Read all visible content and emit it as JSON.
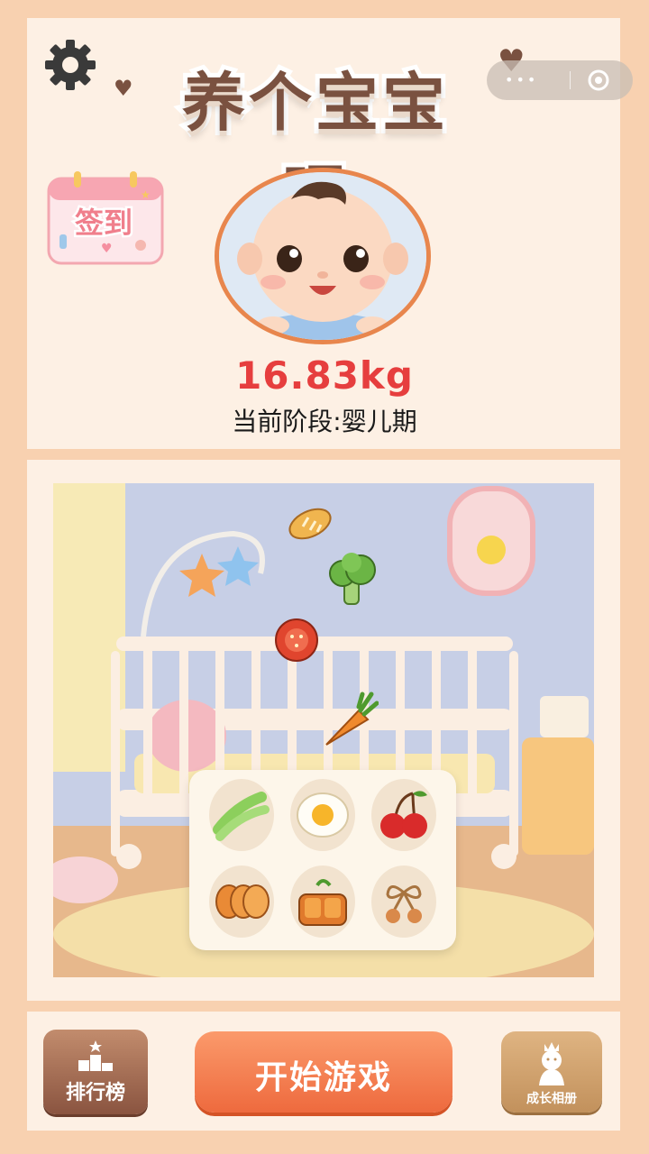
{
  "header": {
    "title": "养个宝宝吧",
    "settings_icon": "gear-icon",
    "checkin_label": "签到"
  },
  "baby": {
    "weight": "16.83kg",
    "stage": "当前阶段:婴儿期"
  },
  "capsule": {
    "dots": "•••"
  },
  "scene": {
    "falling_items": [
      "bread-icon",
      "broccoli-icon",
      "tomato-icon",
      "carrot-icon"
    ],
    "food_items": [
      "celery-icon",
      "fried-egg-icon",
      "cherries-icon",
      "sweet-potato-icon",
      "bento-icon",
      "cherry-bow-icon"
    ]
  },
  "footer": {
    "rank_label": "排行榜",
    "start_label": "开始游戏",
    "album_label": "成长相册"
  },
  "colors": {
    "background": "#f8d1b0",
    "panel": "#fdf0e4",
    "weight": "#e63e3e",
    "start_button": "#ee6a3e",
    "rank_button": "#8a5440",
    "album_button": "#c2915c"
  }
}
